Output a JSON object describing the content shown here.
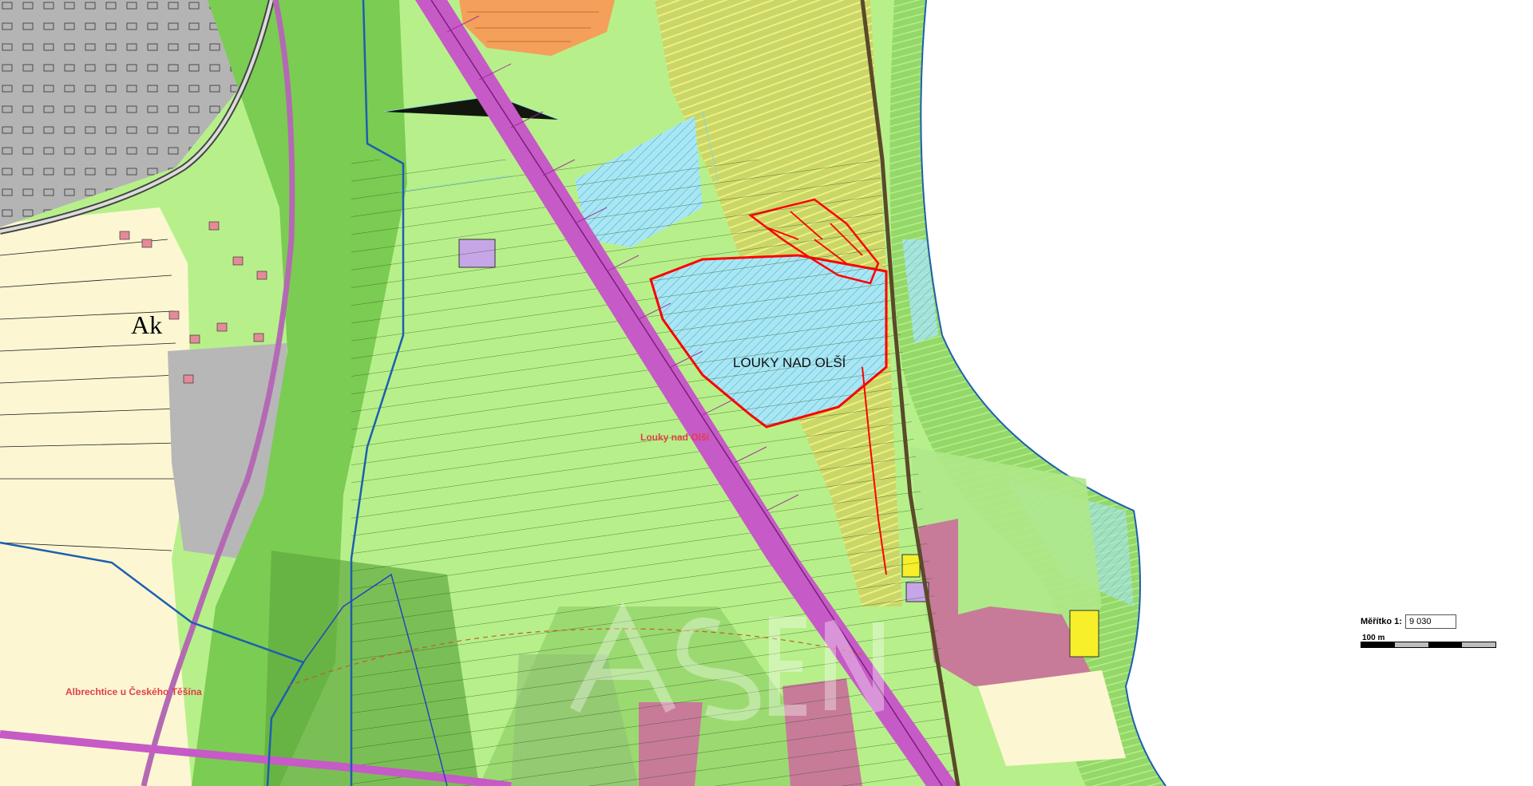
{
  "map": {
    "labels": {
      "locality_main": "LOUKY NAD OLŠÍ",
      "locality_small": "Louky nad Olší",
      "cadastral_bottom": "Albrechtice u Českého Těšína",
      "area_code": "Ak"
    },
    "colors": {
      "light_green": "#b7f08a",
      "mid_green": "#86d05a",
      "dark_green": "#5fb23d",
      "yellow_stripe": "#d8dc52",
      "blue_hatch": "#9ee0f0",
      "pink_built": "#c77b98",
      "cream": "#fcf7d2",
      "gray_industrial": "#b4b4b4",
      "magenta_line": "#c03cc0",
      "red_outline": "#ff0000",
      "blue_boundary": "#1c5fb0"
    }
  },
  "scale": {
    "label": "Měřítko  1:",
    "value": "9 030",
    "bar_text": "100 m"
  }
}
